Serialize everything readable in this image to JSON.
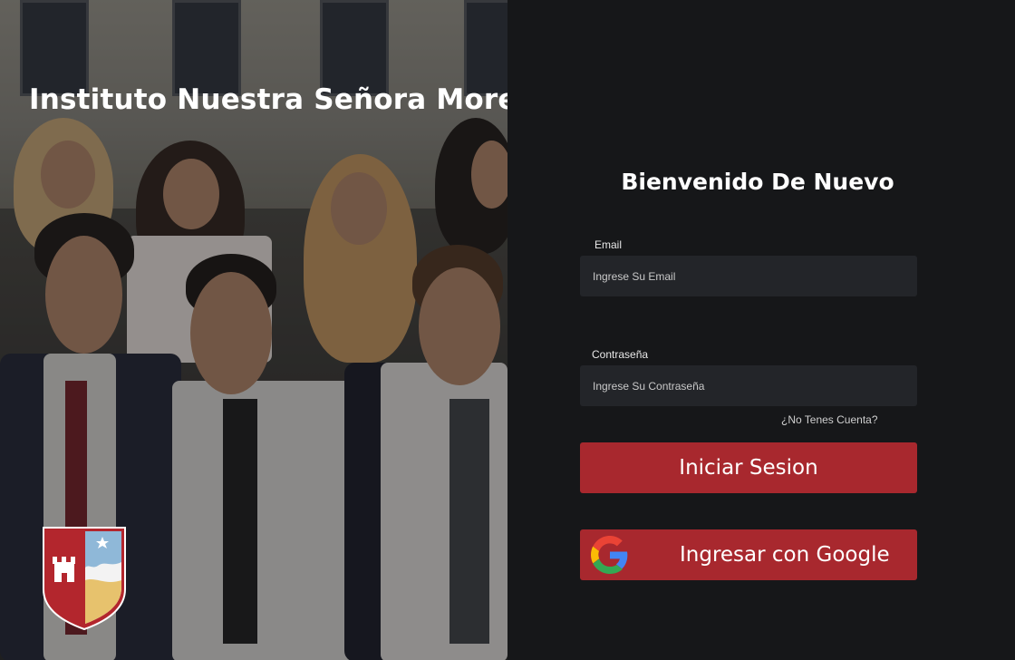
{
  "left_panel": {
    "school_name": "Instituto Nuestra Señora Moreira"
  },
  "login": {
    "heading": "Bienvenido De Nuevo",
    "email_label": "Email",
    "email_placeholder": "Ingrese Su Email",
    "password_label": "Contraseña",
    "password_placeholder": "Ingrese Su Contraseña",
    "register_link": "¿No Tenes Cuenta?",
    "login_button": "Iniciar Sesion",
    "google_button": "Ingresar con Google"
  },
  "colors": {
    "background": "#161719",
    "input_bg": "#232529",
    "primary_button": "#a8282e",
    "crest_red": "#b3262d",
    "crest_blue": "#8fb8d8",
    "crest_gold": "#e7c26d"
  },
  "icons": {
    "crest": "school-crest-icon",
    "google": "google-icon"
  }
}
